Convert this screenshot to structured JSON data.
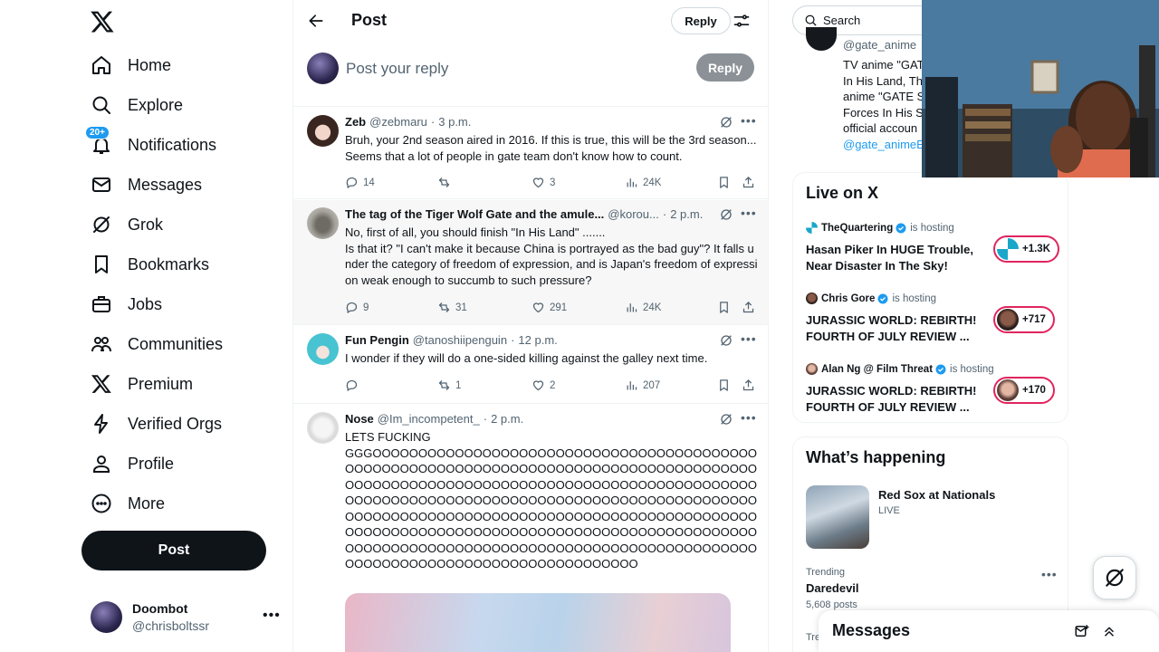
{
  "nav": {
    "items": [
      {
        "label": "Home"
      },
      {
        "label": "Explore"
      },
      {
        "label": "Notifications",
        "badge": "20+"
      },
      {
        "label": "Messages"
      },
      {
        "label": "Grok"
      },
      {
        "label": "Bookmarks"
      },
      {
        "label": "Jobs"
      },
      {
        "label": "Communities"
      },
      {
        "label": "Premium"
      },
      {
        "label": "Verified Orgs"
      },
      {
        "label": "Profile"
      },
      {
        "label": "More"
      }
    ],
    "post_button": "Post",
    "account": {
      "name": "Doombot",
      "handle": "@chrisboltssr"
    }
  },
  "header": {
    "title": "Post",
    "reply_pill": "Reply"
  },
  "composer": {
    "placeholder": "Post your reply",
    "reply_button": "Reply"
  },
  "tweets": [
    {
      "name": "Zeb",
      "handle": "@zebmaru",
      "time": "3 p.m.",
      "text": "Bruh, your 2nd season aired in 2016. If this is true, this will be the 3rd season... Seems that a lot of people in gate team don't know how to count.",
      "replies": "14",
      "reposts": "",
      "likes": "3",
      "views": "24K"
    },
    {
      "name": "The tag of the Tiger Wolf Gate and the amule...",
      "handle": "@korou...",
      "time": "2 p.m.",
      "text": "No, first of all, you should finish \"In His Land\" .......\nIs that it? \"I can't make it because China is portrayed as the bad guy\"? It falls under the category of freedom of expression, and is Japan's freedom of expression weak enough to succumb to such pressure?",
      "replies": "9",
      "reposts": "31",
      "likes": "291",
      "views": "24K"
    },
    {
      "name": "Fun Pengin",
      "handle": "@tanoshiipenguin",
      "time": "12 p.m.",
      "text": "I wonder if they will do a one-sided killing against the galley next time.",
      "replies": "",
      "reposts": "1",
      "likes": "2",
      "views": "207"
    },
    {
      "name": "Nose",
      "handle": "@Im_incompetent_",
      "time": "2 p.m.",
      "text": "LETS FUCKING\nGGGOOOOOOOOOOOOOOOOOOOOOOOOOOOOOOOOOOOOOOOOOOOOOOOOOOOOOOOOOOOOOOOOOOOOOOOOOOOOOOOOOOOOOOOOOOOOOOOOOOOOOOOOOOOOOOOOOOOOOOOOOOOOOOOOOOOOOOOOOOOOOOOOOOOOOOOOOOOOOOOOOOOOOOOOOOOOOOOOOOOOOOOOOOOOOOOOOOOOOOOOOOOOOOOOOOOOOOOOOOOOOOOOOOOOOOOOOOOOOOOOOOOOOOOOOOOOOOOOOOOOOOOOOOOOOOOOOOOOOOOOOOOOOOOOOOOOOOOOOOOOOOOOOOOOOOOOOOOOOOOOOOOOOOOOOOOOOOOOOOOOOOOO"
    }
  ],
  "right": {
    "search_placeholder": "Search",
    "prev_card": {
      "handle": "@gate_anime",
      "lines": [
        "TV anime \"GAT",
        "In His Land, Th",
        "anime \"GATE S",
        "Forces In His S",
        "official accoun"
      ],
      "link": "@gate_animeE"
    },
    "live": {
      "title": "Live on X",
      "is_hosting": "is hosting",
      "items": [
        {
          "host": "TheQuartering",
          "title": "Hasan Piker In HUGE Trouble, Near Disaster In The Sky!",
          "count": "+1.3K"
        },
        {
          "host": "Chris Gore",
          "title": "JURASSIC WORLD: REBIRTH! FOURTH OF JULY REVIEW ...",
          "count": "+717"
        },
        {
          "host": "Alan Ng @ Film Threat",
          "title": "JURASSIC WORLD: REBIRTH! FOURTH OF JULY REVIEW ...",
          "count": "+170"
        }
      ]
    },
    "happening": {
      "title": "What’s happening",
      "event": {
        "name": "Red Sox at Nationals",
        "status": "LIVE"
      },
      "trend": {
        "label": "Trending",
        "name": "Daredevil",
        "count": "5,608 posts"
      },
      "next_label": "Tre"
    },
    "messages_drawer": "Messages"
  },
  "colors": {
    "accent": "#1d9bf0",
    "text": "#0f1419",
    "muted": "#536471",
    "live_ring": "#e0245e"
  }
}
